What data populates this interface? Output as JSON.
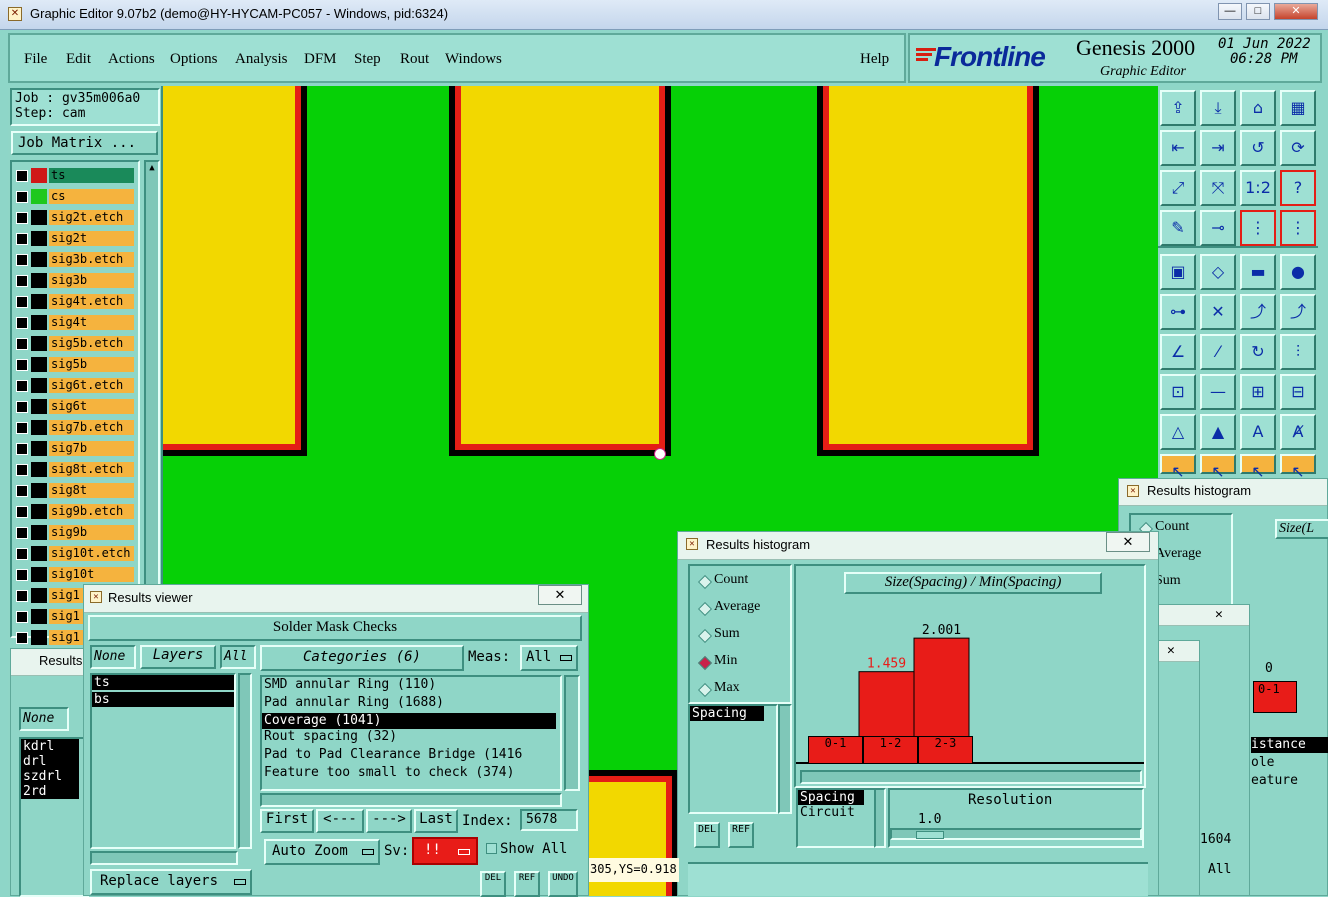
{
  "window": {
    "title": "Graphic Editor 9.07b2 (demo@HY-HYCAM-PC057 - Windows, pid:6324)",
    "min": "—",
    "max": "□",
    "close": "✕"
  },
  "menu": {
    "items": [
      "File",
      "Edit",
      "Actions",
      "Options",
      "Analysis",
      "DFM",
      "Step",
      "Rout",
      "Windows"
    ],
    "help": "Help"
  },
  "brand": {
    "logo": "Frontline",
    "product": "Genesis 2000",
    "subtitle": "Graphic Editor",
    "date": "01 Jun 2022",
    "time": "06:28 PM"
  },
  "job": {
    "job_label": "Job : gv35m006a0",
    "step_label": "Step: cam",
    "matrix_button": "Job Matrix ..."
  },
  "layers": [
    {
      "name": "ts",
      "color": "#1a8a5a",
      "ind": "#d01818"
    },
    {
      "name": "cs",
      "color": "#f5b33e",
      "ind": "#1ec81e"
    },
    {
      "name": "sig2t.etch",
      "color": "#f5b33e",
      "ind": "#000000"
    },
    {
      "name": "sig2t",
      "color": "#f5b33e",
      "ind": "#000000"
    },
    {
      "name": "sig3b.etch",
      "color": "#f5b33e",
      "ind": "#000000"
    },
    {
      "name": "sig3b",
      "color": "#f5b33e",
      "ind": "#000000"
    },
    {
      "name": "sig4t.etch",
      "color": "#f5b33e",
      "ind": "#000000"
    },
    {
      "name": "sig4t",
      "color": "#f5b33e",
      "ind": "#000000"
    },
    {
      "name": "sig5b.etch",
      "color": "#f5b33e",
      "ind": "#000000"
    },
    {
      "name": "sig5b",
      "color": "#f5b33e",
      "ind": "#000000"
    },
    {
      "name": "sig6t.etch",
      "color": "#f5b33e",
      "ind": "#000000"
    },
    {
      "name": "sig6t",
      "color": "#f5b33e",
      "ind": "#000000"
    },
    {
      "name": "sig7b.etch",
      "color": "#f5b33e",
      "ind": "#000000"
    },
    {
      "name": "sig7b",
      "color": "#f5b33e",
      "ind": "#000000"
    },
    {
      "name": "sig8t.etch",
      "color": "#f5b33e",
      "ind": "#000000"
    },
    {
      "name": "sig8t",
      "color": "#f5b33e",
      "ind": "#000000"
    },
    {
      "name": "sig9b.etch",
      "color": "#f5b33e",
      "ind": "#000000"
    },
    {
      "name": "sig9b",
      "color": "#f5b33e",
      "ind": "#000000"
    },
    {
      "name": "sig10t.etch",
      "color": "#f5b33e",
      "ind": "#000000"
    },
    {
      "name": "sig10t",
      "color": "#f5b33e",
      "ind": "#000000"
    },
    {
      "name": "sig1",
      "color": "#f5b33e",
      "ind": "#000000"
    },
    {
      "name": "sig1",
      "color": "#f5b33e",
      "ind": "#000000"
    },
    {
      "name": "sig1",
      "color": "#f5b33e",
      "ind": "#000000"
    }
  ],
  "colors": {
    "board": "#06d006",
    "pad_fill": "#f2d800",
    "pad_ring": "#e41e16",
    "panel": "#8fd6c7",
    "bar": "#e81c18"
  },
  "results_viewer": {
    "title": "Results viewer",
    "header": "Solder Mask Checks",
    "none_btn": "None",
    "layers_btn": "Layers",
    "all_btn": "All",
    "categories_btn": "Categories (6)",
    "meas_label": "Meas:",
    "meas_value": "All",
    "layers": [
      "ts",
      "bs"
    ],
    "categories": [
      "SMD annular Ring (110)",
      "Pad annular Ring (1688)",
      "Coverage (1041)",
      "Rout spacing (32)",
      "Pad to Pad Clearance Bridge (1416",
      "Feature too small to check (374)"
    ],
    "first": "First",
    "prev": "<---",
    "next": "--->",
    "last": "Last",
    "index_label": "Index:",
    "index_value": "5678",
    "auto_zoom": "Auto Zoom",
    "sv_label": "Sv:",
    "sv_value": "!!",
    "show_all": "Show All",
    "replace_layers": "Replace layers",
    "del": "DEL",
    "ref": "REF",
    "undo": "UNDO"
  },
  "status_text": "305,YS=0.918",
  "results_small": {
    "title": "Results",
    "none_btn": "None",
    "items": [
      "kdrl",
      "drl",
      "szdrl",
      "2rd"
    ]
  },
  "histogram": {
    "title": "Results histogram",
    "modes": [
      "Count",
      "Average",
      "Sum",
      "Min",
      "Max"
    ],
    "selected_mode": "Min",
    "chart_title": "Size(Spacing) / Min(Spacing)",
    "list_items": [
      "Spacing"
    ],
    "type_items": [
      "Spacing",
      "Circuit"
    ],
    "resolution_label": "Resolution",
    "resolution_value": "1.0",
    "del": "DEL",
    "ref": "REF"
  },
  "chart_data": {
    "type": "bar",
    "title": "Size(Spacing) / Min(Spacing)",
    "categories": [
      "0-1",
      "1-2",
      "2-3"
    ],
    "values": [
      0,
      1.459,
      2.001
    ],
    "value_labels": [
      "0",
      "1.459",
      "2.001"
    ],
    "xlabel": "",
    "ylabel": "",
    "ylim": [
      0,
      2.1
    ],
    "grid": false
  },
  "histogram_back": {
    "title": "Results histogram",
    "modes": [
      "Count",
      "Average",
      "Sum"
    ],
    "chart_title": "Size(L",
    "zero": "0",
    "bar_label": "0-1",
    "list_items": [
      "istance",
      "ole",
      "eature"
    ],
    "num": "1604",
    "all": "All"
  }
}
